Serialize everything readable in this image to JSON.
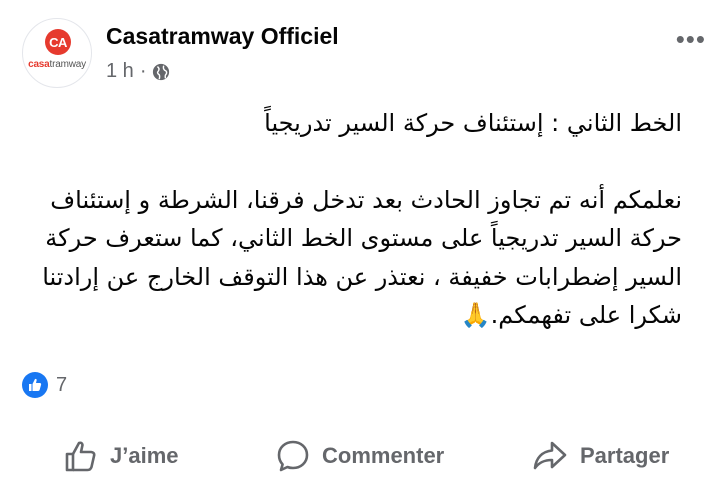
{
  "post": {
    "page_name": "Casatramway Officiel",
    "time": "1 h",
    "separator": "·",
    "avatar_logo_mark": "CA",
    "avatar_logo_text_a": "casa",
    "avatar_logo_text_b": "tramway",
    "more_label": "•••",
    "text": {
      "line1": "الخط  الثاني : إستئناف حركة السير تدريجياً",
      "line2": "نعلمكم أنه تم تجاوز الحادث بعد تدخل فرقنا، الشرطة  و إستئناف",
      "line3": "حركة السير تدريجياً على مستوى الخط الثاني، كما ستعرف حركة",
      "line4": "السير إضطرابات خفيفة ، نعتذر عن هذا التوقف الخارج عن إرادتنا",
      "line5": "شكرا على تفهمكم.🙏"
    }
  },
  "reactions": {
    "count": "7"
  },
  "actions": {
    "like_label": "J’aime",
    "comment_label": "Commenter",
    "share_label": "Partager"
  },
  "colors": {
    "brand_red": "#e63a2e",
    "facebook_blue": "#1877f2",
    "secondary_text": "#65676b"
  },
  "icons": [
    "globe-icon",
    "like-badge-icon",
    "thumbs-up-icon",
    "comment-icon",
    "share-icon",
    "more-options-icon"
  ]
}
